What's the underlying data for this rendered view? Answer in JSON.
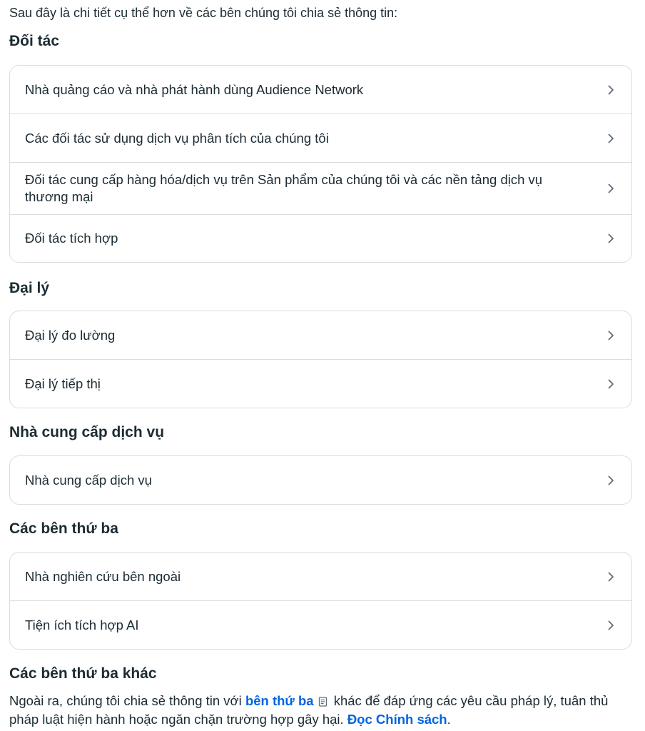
{
  "intro": "Sau đây là chi tiết cụ thể hơn về các bên chúng tôi chia sẻ thông tin:",
  "sections": [
    {
      "heading": "Đối tác",
      "items": [
        "Nhà quảng cáo và nhà phát hành dùng Audience Network",
        "Các đối tác sử dụng dịch vụ phân tích của chúng tôi",
        "Đối tác cung cấp hàng hóa/dịch vụ trên Sản phẩm của chúng tôi và các nền tảng dịch vụ thương mại",
        "Đối tác tích hợp"
      ]
    },
    {
      "heading": "Đại lý",
      "items": [
        "Đại lý đo lường",
        "Đại lý tiếp thị"
      ]
    },
    {
      "heading": "Nhà cung cấp dịch vụ",
      "items": [
        "Nhà cung cấp dịch vụ"
      ]
    },
    {
      "heading": "Các bên thứ ba",
      "items": [
        "Nhà nghiên cứu bên ngoài",
        "Tiện ích tích hợp AI"
      ]
    },
    {
      "heading": "Các bên thứ ba khác",
      "items": []
    }
  ],
  "footer": {
    "text_before": "Ngoài ra, chúng tôi chia sẻ thông tin với ",
    "link1": "bên thứ ba",
    "link1_icon": "document-icon",
    "text_middle": " khác để đáp ứng các yêu cầu pháp lý, tuân thủ pháp luật hiện hành hoặc ngăn chặn trường hợp gây hại. ",
    "link2": "Đọc Chính sách",
    "text_after": "."
  },
  "colors": {
    "text": "#1c2b33",
    "link": "#0064e0",
    "border": "#dadde1",
    "chevron": "#5d6c7b"
  },
  "icons": {
    "row_action": "chevron-right-icon"
  }
}
